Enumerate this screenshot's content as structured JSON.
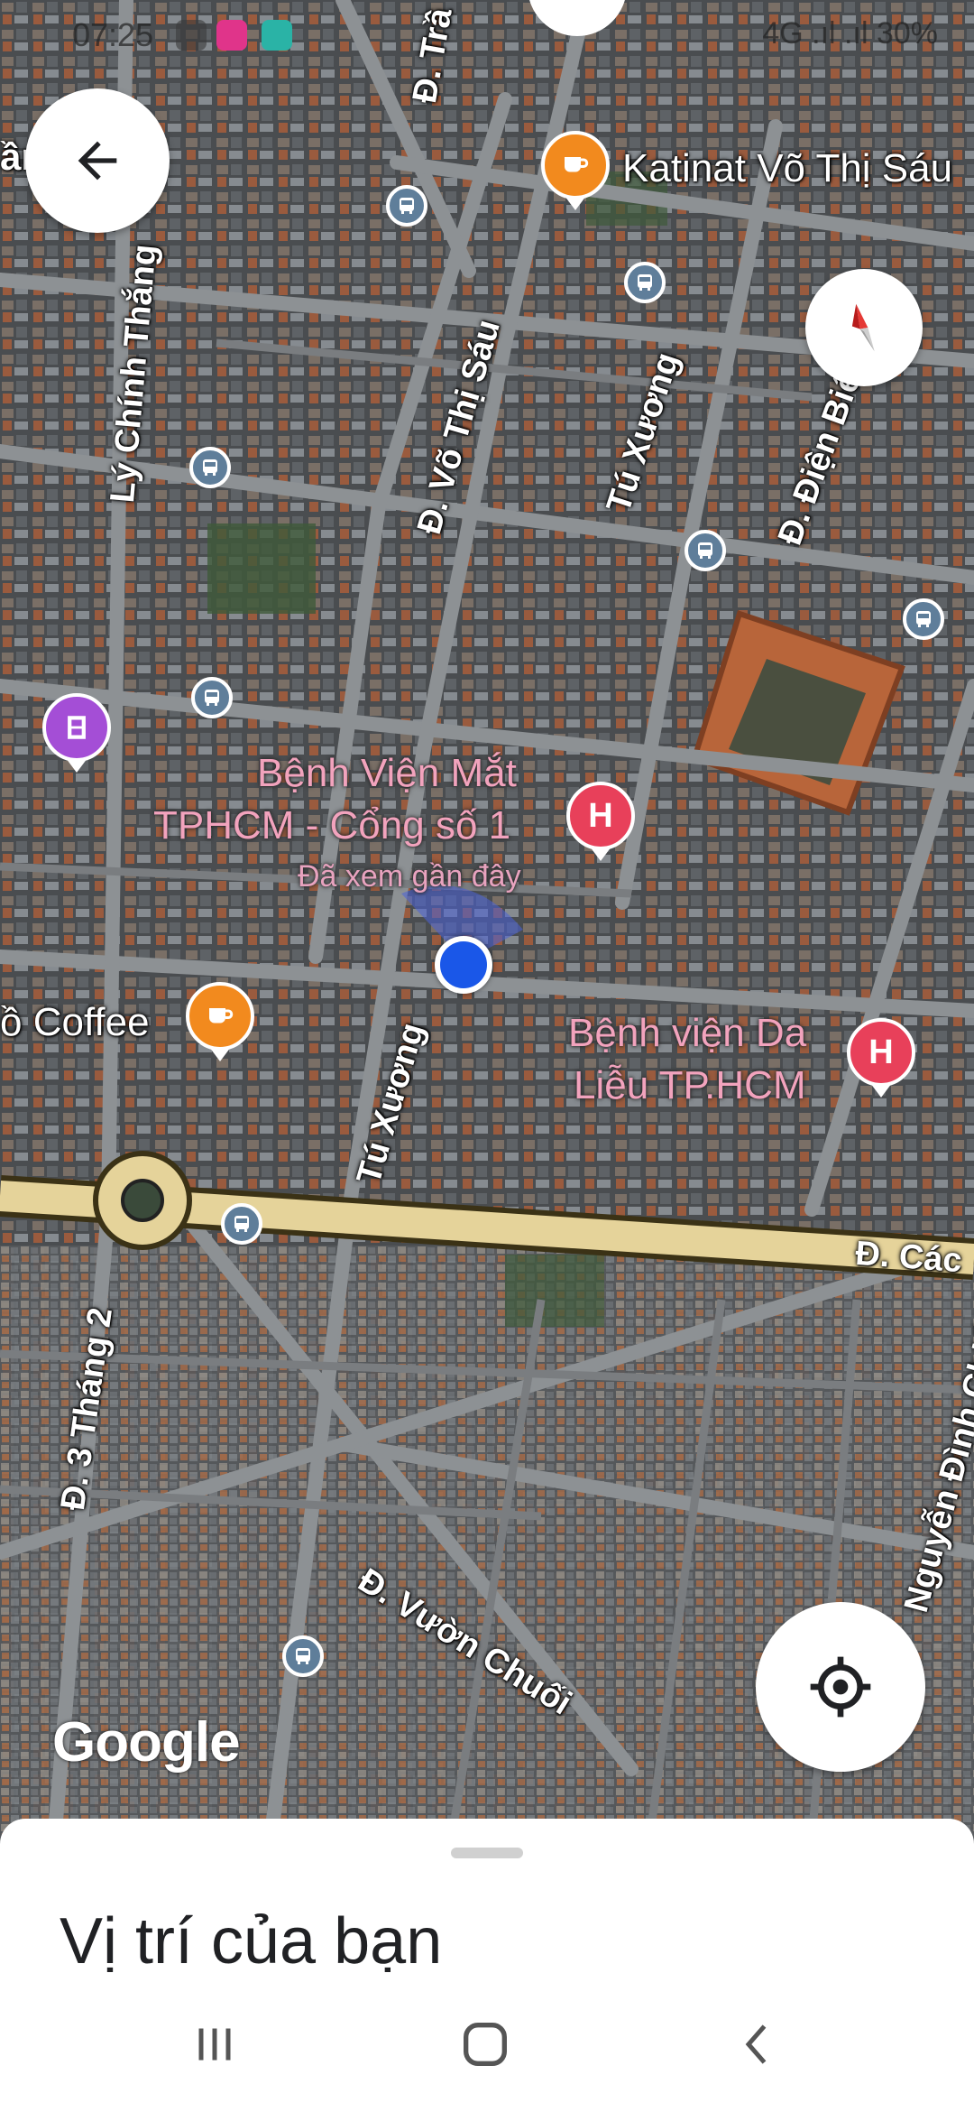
{
  "status_bar": {
    "time": "07:25",
    "app_icons": [
      "zalo-icon",
      "lazada-icon",
      "tasks-icon"
    ],
    "right_text": "4G .ıl .ıl 30%"
  },
  "map": {
    "streets": {
      "vo_thi_sau": "Đ. Võ Thị Sáu",
      "tu_xuong_upper": "Tú Xương",
      "tu_xuong_lower": "Tú Xương",
      "ly_chinh_thang": "Lý Chính Thắng",
      "dien_bien_phu": "Đ. Điện Biên Phủ",
      "cach_mang": "Đ. Các",
      "ba_thang_hai": "Đ. 3 Tháng 2",
      "vuon_chuoi": "Đ. Vườn Chuối",
      "nguyen_dinh_chieu": "Nguyễn Đình Chiểu",
      "tran": "Đ. Trầ",
      "top_left_partial": "ần Thảo"
    },
    "pois": {
      "katinat": "Katinat Võ Thị Sáu",
      "coffee_partial": "ồ Coffee",
      "hospital_eye_line1": "Bệnh Viện Mắt",
      "hospital_eye_line2": "TPHCM - Cổng số 1",
      "hospital_eye_sub": "Đã xem gần đây",
      "hospital_derm_line1": "Bệnh viện Da",
      "hospital_derm_line2": "Liễu TP.HCM"
    },
    "hospital_pin_glyph": "H",
    "google_logo": "Google",
    "colors": {
      "cafe": "#f28a1e",
      "hospital": "#e8405a",
      "cinema": "#a44ed6",
      "location_dot": "#1a57e8",
      "bus_stop": "#5f7e9a",
      "main_road": "#e5d39a"
    }
  },
  "controls": {
    "back": "arrow-left-icon",
    "compass": "compass-icon",
    "locate": "my-location-icon"
  },
  "bottom_sheet": {
    "title": "Vị trí của bạn"
  },
  "nav_bar": {
    "recent": "recent-apps-icon",
    "home": "home-icon",
    "back": "back-icon"
  }
}
